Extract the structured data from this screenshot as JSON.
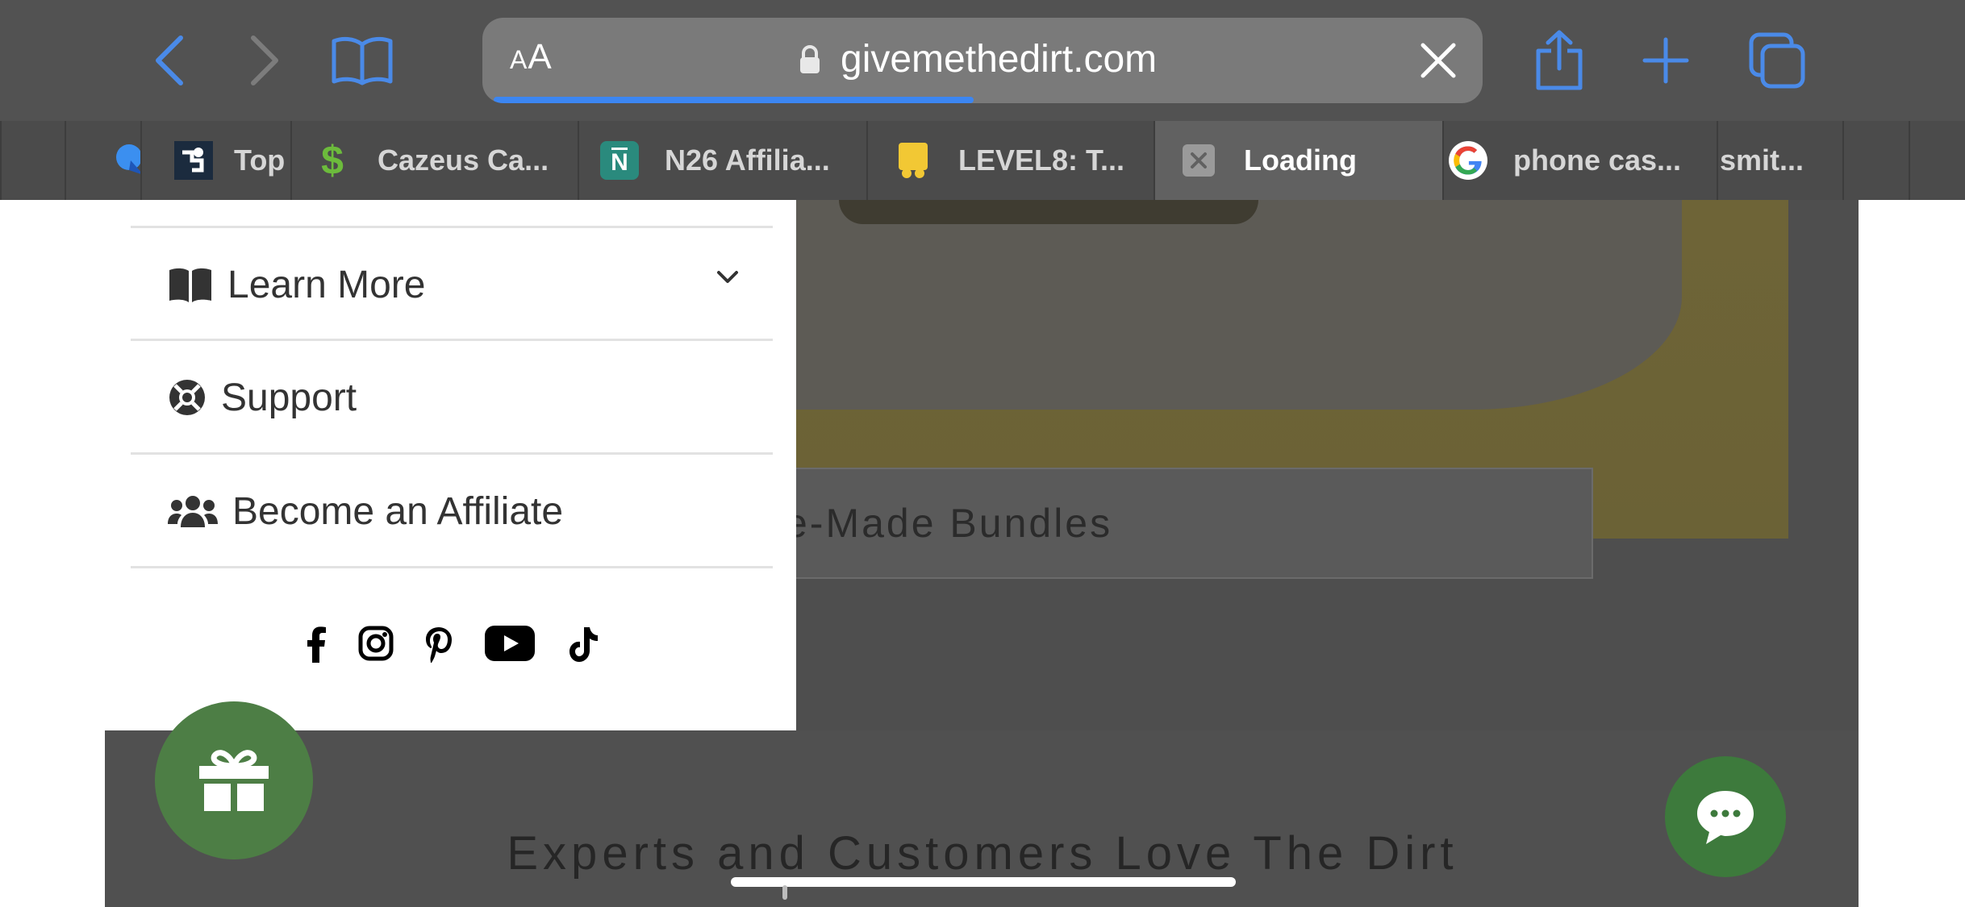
{
  "browser": {
    "url": "givemethedirt.com",
    "text_size_label": "AA",
    "load_progress": 0.48,
    "accent_color": "#3c86f2",
    "buttons": [
      "back-icon",
      "forward-icon",
      "bookmarks-icon",
      "share-icon",
      "new-tab-icon",
      "tabs-icon"
    ]
  },
  "tabs": [
    {
      "title": "",
      "icon": "blue-app-icon"
    },
    {
      "title": "Top",
      "icon": "puzzle-logo-icon"
    },
    {
      "title": "Cazeus Ca...",
      "icon": "dollar-icon"
    },
    {
      "title": "N26 Affilia...",
      "icon": "n26-icon"
    },
    {
      "title": "LEVEL8: T...",
      "icon": "level8-icon"
    },
    {
      "title": "Loading",
      "icon": "close-tab-icon",
      "active": true
    },
    {
      "title": "phone cas...",
      "icon": "google-icon"
    },
    {
      "title": "smit...",
      "icon": ""
    }
  ],
  "menu": {
    "items": [
      {
        "label": "Learn More",
        "icon": "book-icon",
        "expandable": true
      },
      {
        "label": "Support",
        "icon": "lifering-icon"
      },
      {
        "label": "Become an Affiliate",
        "icon": "users-icon"
      }
    ],
    "social": [
      "facebook-icon",
      "instagram-icon",
      "pinterest-icon",
      "youtube-icon",
      "tiktok-icon"
    ]
  },
  "page": {
    "bundle_button_label": "Pre-Made Bundles",
    "section_heading": "Experts and Customers Love The Dirt"
  },
  "colors": {
    "brand_green": "#4d7e45",
    "chat_green": "#3d7a3c"
  }
}
